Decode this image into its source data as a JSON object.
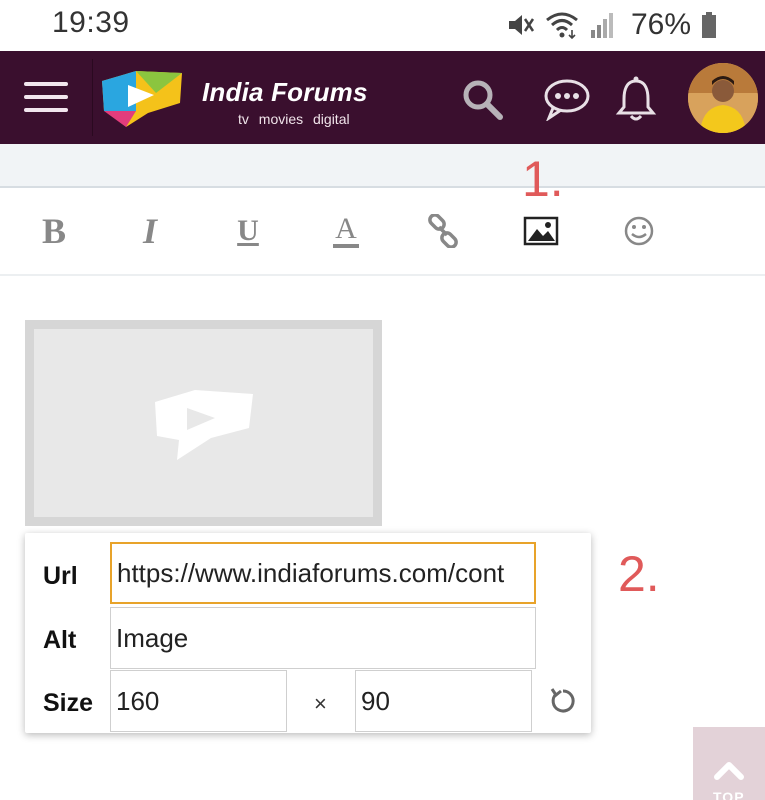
{
  "status_bar": {
    "time": "19:39",
    "battery": "76%",
    "icons": [
      "mute-icon",
      "wifi-icon",
      "signal-icon",
      "battery-icon"
    ]
  },
  "header": {
    "brand_name": "India Forums",
    "tagline": "tv movies digital",
    "icons": [
      "menu-icon",
      "search-icon",
      "chat-icon",
      "bell-icon"
    ],
    "bg_color": "#3a0f2e"
  },
  "toolbar": {
    "buttons": [
      {
        "name": "bold",
        "glyph": "B"
      },
      {
        "name": "italic",
        "glyph": "I"
      },
      {
        "name": "underline",
        "glyph": "U"
      },
      {
        "name": "font-color",
        "glyph": "A"
      },
      {
        "name": "link",
        "icon": "link-icon"
      },
      {
        "name": "image",
        "icon": "image-icon"
      },
      {
        "name": "emoji",
        "icon": "smiley-icon"
      }
    ]
  },
  "annotations": {
    "step1": "1.",
    "step2": "2.",
    "color": "#e05a5a"
  },
  "image_props": {
    "url_label": "Url",
    "url_value": "https://www.indiaforums.com/cont",
    "alt_label": "Alt",
    "alt_value": "Image",
    "size_label": "Size",
    "width_value": "160",
    "times": "×",
    "height_value": "90",
    "focus_color": "#e8a32a"
  },
  "scroll_top": {
    "label": "TOP"
  }
}
